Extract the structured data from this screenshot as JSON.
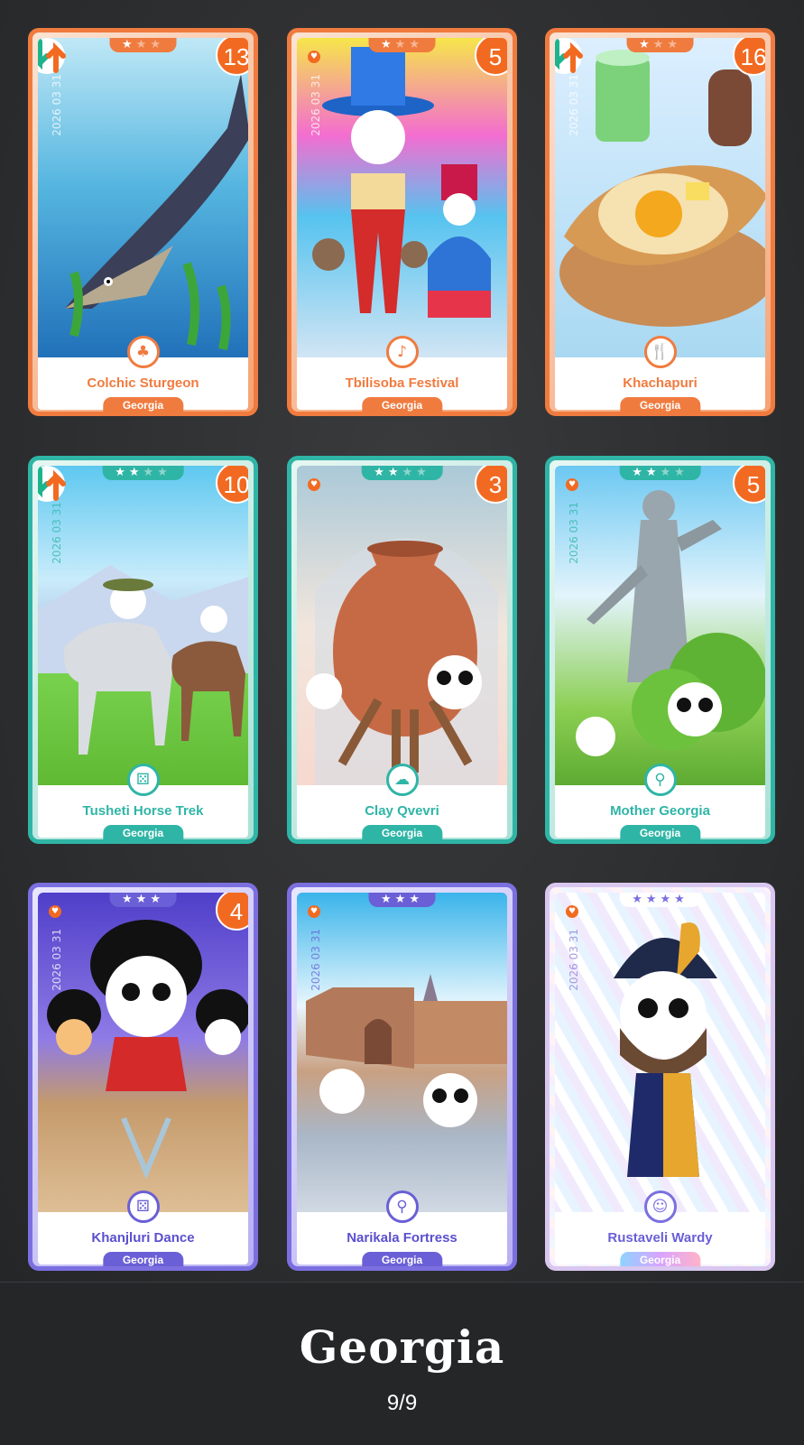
{
  "cards": [
    {
      "name": "Colchic Sturgeon",
      "region": "Georgia",
      "stars_filled": 1,
      "stars_total": 3,
      "count": "13",
      "date": "2026 03 31",
      "rarity": "common",
      "category_icon": "tree-icon",
      "has_swap_badge": true,
      "has_heart": false
    },
    {
      "name": "Tbilisoba Festival",
      "region": "Georgia",
      "stars_filled": 1,
      "stars_total": 3,
      "count": "5",
      "date": "2026 03 31",
      "rarity": "common",
      "category_icon": "music-note-icon",
      "has_swap_badge": false,
      "has_heart": true
    },
    {
      "name": "Khachapuri",
      "region": "Georgia",
      "stars_filled": 1,
      "stars_total": 3,
      "count": "16",
      "date": "2026 03 31",
      "rarity": "common",
      "category_icon": "fork-knife-icon",
      "has_swap_badge": true,
      "has_heart": false
    },
    {
      "name": "Tusheti Horse Trek",
      "region": "Georgia",
      "stars_filled": 2,
      "stars_total": 4,
      "count": "10",
      "date": "2026 03 31",
      "rarity": "uncommon",
      "category_icon": "dice-icon",
      "has_swap_badge": true,
      "has_heart": false
    },
    {
      "name": "Clay Qvevri",
      "region": "Georgia",
      "stars_filled": 2,
      "stars_total": 4,
      "count": "3",
      "date": "2026 03 31",
      "rarity": "uncommon",
      "category_icon": "hat-icon",
      "has_swap_badge": false,
      "has_heart": true
    },
    {
      "name": "Mother Georgia",
      "region": "Georgia",
      "stars_filled": 2,
      "stars_total": 4,
      "count": "5",
      "date": "2026 03 31",
      "rarity": "uncommon",
      "category_icon": "location-pin-icon",
      "has_swap_badge": false,
      "has_heart": true
    },
    {
      "name": "Khanjluri Dance",
      "region": "Georgia",
      "stars_filled": 3,
      "stars_total": 3,
      "count": "4",
      "date": "2026 03 31",
      "rarity": "rare",
      "category_icon": "dice-icon",
      "has_swap_badge": false,
      "has_heart": true
    },
    {
      "name": "Narikala Fortress",
      "region": "Georgia",
      "stars_filled": 3,
      "stars_total": 3,
      "count": "",
      "date": "2026 03 31",
      "rarity": "rare",
      "category_icon": "location-pin-icon",
      "has_swap_badge": false,
      "has_heart": true
    },
    {
      "name": "Rustaveli Wardy",
      "region": "Georgia",
      "stars_filled": 4,
      "stars_total": 4,
      "count": "",
      "date": "2026 03 31",
      "rarity": "legendary",
      "category_icon": "person-icon",
      "has_swap_badge": false,
      "has_heart": true
    }
  ],
  "footer": {
    "title": "Georgia",
    "progress": "9/9"
  },
  "icons": {
    "tree-icon": "♣",
    "music-note-icon": "♪",
    "fork-knife-icon": "🍴",
    "dice-icon": "⚄",
    "hat-icon": "☁",
    "location-pin-icon": "⚲",
    "person-icon": "☺"
  },
  "colors": {
    "count_badge": "#f26a21",
    "common": "#f07b3f",
    "uncommon": "#2fb5a6",
    "rare": "#6a5fd6",
    "legendary": "#d9c7f0"
  }
}
